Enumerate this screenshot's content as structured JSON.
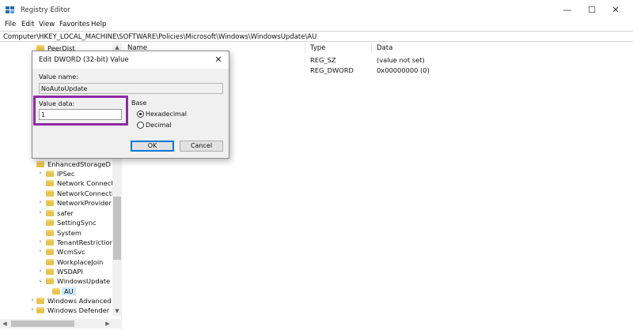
{
  "window": {
    "title": "Registry Editor",
    "controls": {
      "minimize": "—",
      "maximize": "☐",
      "close": "✕"
    }
  },
  "menu": [
    "File",
    "Edit",
    "View",
    "Favorites",
    "Help"
  ],
  "address": "Computer\\HKEY_LOCAL_MACHINE\\SOFTWARE\\Policies\\Microsoft\\Windows\\WindowsUpdate\\AU",
  "tree": {
    "items": [
      {
        "label": "PeerDist",
        "expander": ""
      },
      {
        "label": "EnhancedStorageD",
        "expander": ""
      },
      {
        "label": "IPSec",
        "expander": "›"
      },
      {
        "label": "Network Connectic",
        "expander": ""
      },
      {
        "label": "NetworkConnectivi",
        "expander": ""
      },
      {
        "label": "NetworkProvider",
        "expander": "›"
      },
      {
        "label": "safer",
        "expander": "›"
      },
      {
        "label": "SettingSync",
        "expander": ""
      },
      {
        "label": "System",
        "expander": ""
      },
      {
        "label": "TenantRestrictions",
        "expander": "›"
      },
      {
        "label": "WcmSvc",
        "expander": "›"
      },
      {
        "label": "WorkplaceJoin",
        "expander": ""
      },
      {
        "label": "WSDAPI",
        "expander": "›"
      },
      {
        "label": "WindowsUpdate",
        "expander": "⌄"
      },
      {
        "label": "AU",
        "expander": "",
        "selected": true
      },
      {
        "label": "Windows Advanced T",
        "expander": "›"
      },
      {
        "label": "Windows Defender",
        "expander": "›"
      }
    ]
  },
  "list": {
    "headers": {
      "name": "Name",
      "type": "Type",
      "data": "Data"
    },
    "rows": [
      {
        "type": "REG_SZ",
        "data": "(value not set)"
      },
      {
        "type": "REG_DWORD",
        "data": "0x00000000 (0)"
      }
    ]
  },
  "dialog": {
    "title": "Edit DWORD (32-bit) Value",
    "value_name_label": "Value name:",
    "value_name": "NoAutoUpdate",
    "value_data_label": "Value data:",
    "value_data": "1",
    "base_label": "Base",
    "hex_label": "Hexadecimal",
    "dec_label": "Decimal",
    "ok": "OK",
    "cancel": "Cancel",
    "close": "✕"
  },
  "colors": {
    "highlight": "#8e2aa6",
    "folder": "#e8c44f",
    "selection": "#cce8ff"
  }
}
